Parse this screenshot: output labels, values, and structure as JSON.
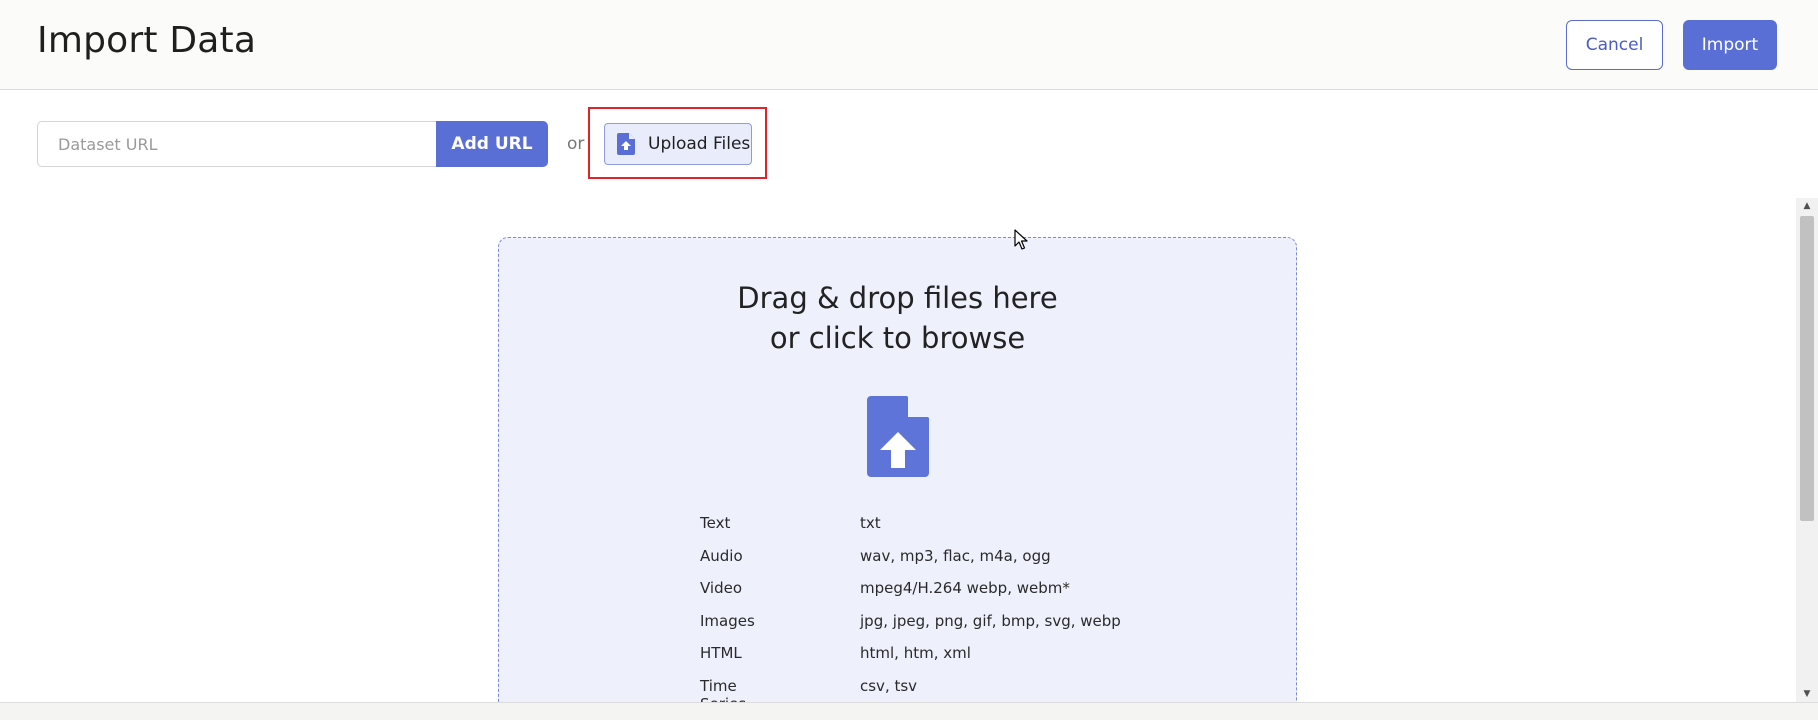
{
  "header": {
    "title": "Import Data",
    "cancel_label": "Cancel",
    "import_label": "Import"
  },
  "url_bar": {
    "placeholder": "Dataset URL",
    "value": "",
    "add_url_label": "Add URL",
    "or_text": "or",
    "upload_label": "Upload Files",
    "upload_icon": "file-upload-icon"
  },
  "dropzone": {
    "line1": "Drag & drop files here",
    "line2": "or click to browse",
    "icon": "file-upload-icon",
    "formats": [
      {
        "type": "Text",
        "extensions": "txt"
      },
      {
        "type": "Audio",
        "extensions": "wav, mp3, flac, m4a, ogg"
      },
      {
        "type": "Video",
        "extensions": "mpeg4/H.264 webp, webm*"
      },
      {
        "type": "Images",
        "extensions": "jpg, jpeg, png, gif, bmp, svg, webp"
      },
      {
        "type": "HTML",
        "extensions": "html, htm, xml"
      },
      {
        "type": "Time Series",
        "extensions": "csv, tsv"
      }
    ]
  },
  "colors": {
    "accent": "#5a6fd6",
    "dropzone_bg": "#eef1fc",
    "highlight": "#e0242a"
  }
}
